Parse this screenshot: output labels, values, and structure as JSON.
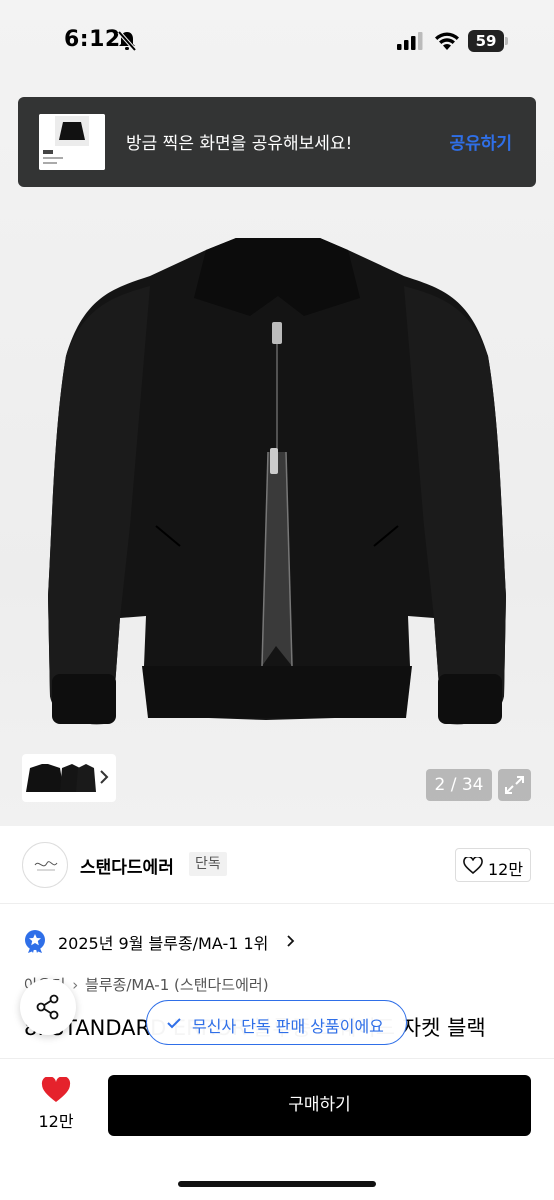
{
  "status_bar": {
    "time": "6:12",
    "battery": "59"
  },
  "toast": {
    "message": "방금 찍은 화면을 공유해보세요!",
    "action_label": "공유하기"
  },
  "gallery": {
    "counter": "2 / 34"
  },
  "brand": {
    "name": "스탠다드에러",
    "badge": "단독",
    "likes": "12만"
  },
  "ranking": {
    "text": "2025년 9월 블루종/MA-1 1위"
  },
  "breadcrumb": {
    "root": "아우터",
    "category": "블루종/MA-1",
    "brand": "(스탠다드에러)"
  },
  "product": {
    "title": "8. STANDARD ERROR 블루종 스웨이드 자켓 블랙"
  },
  "exclusive_pill": {
    "label": "무신사 단독 판매 상품이에요"
  },
  "bottom_bar": {
    "likes": "12만",
    "buy_label": "구매하기"
  },
  "colors": {
    "accent_blue": "#2f6fe8",
    "heart_red": "#e5222c",
    "toast_bg": "#333434"
  }
}
